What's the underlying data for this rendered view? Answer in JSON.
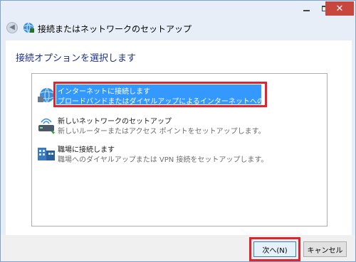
{
  "window": {
    "title_buttons": {
      "minimize": "─",
      "maximize": "□",
      "close": "✕"
    }
  },
  "header": {
    "back_icon": "◀",
    "title": "接続またはネットワークのセットアップ"
  },
  "main": {
    "heading": "接続オプションを選択します",
    "options": [
      {
        "title": "インターネットに接続します",
        "desc": "ブロードバンドまたはダイヤルアップによるインターネットへの接続を設定します。",
        "icon": "globe-network-icon",
        "selected": true
      },
      {
        "title": "新しいネットワークのセットアップ",
        "desc": "新しいルーターまたはアクセス ポイントをセットアップします。",
        "icon": "router-icon",
        "selected": false
      },
      {
        "title": "職場に接続します",
        "desc": "職場へのダイヤルアップまたは VPN 接続をセットアップします。",
        "icon": "workplace-icon",
        "selected": false
      }
    ]
  },
  "footer": {
    "next_label": "次へ(N)",
    "cancel_label": "キャンセル"
  },
  "colors": {
    "selection": "#3399ff",
    "highlight_box": "#e0242f",
    "heading": "#1e3287",
    "close_button": "#c7463e"
  }
}
